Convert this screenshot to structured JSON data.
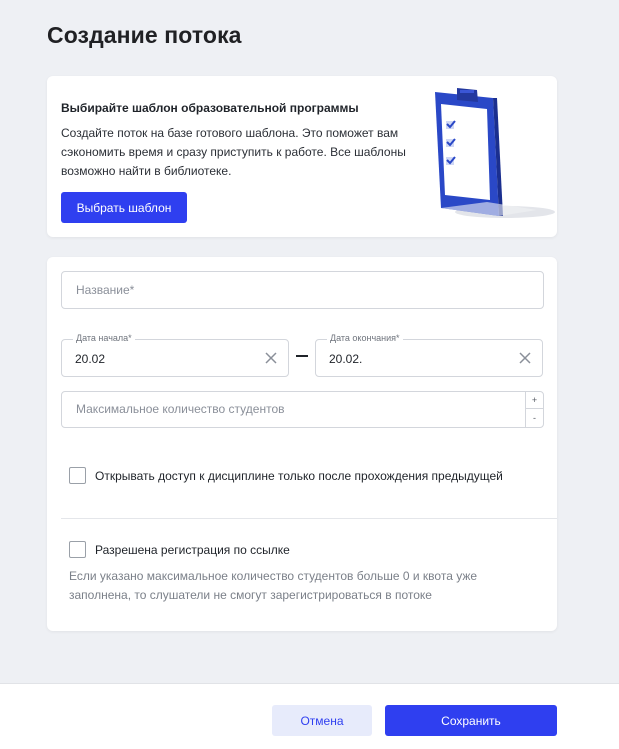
{
  "page": {
    "title": "Создание потока"
  },
  "template_promo": {
    "title": "Выбирайте шаблон образовательной программы",
    "text": "Создайте поток на базе готового шаблона. Это поможет вам сэкономить время и сразу приступить к работе. Все шаблоны возможно найти в библиотеке.",
    "choose_button": "Выбрать шаблон",
    "illustration": "clipboard-checklist-icon"
  },
  "form": {
    "name": {
      "placeholder": "Название*",
      "value": ""
    },
    "start_date": {
      "label": "Дата начала*",
      "value": "20.02"
    },
    "end_date": {
      "label": "Дата окончания*",
      "value": "20.02."
    },
    "separator": "—",
    "max_students": {
      "placeholder": "Максимальное количество студентов",
      "value": "",
      "plus": "+",
      "minus": "-"
    },
    "access_checkbox": {
      "label": "Открывать доступ к дисциплине только после прохождения предыдущей",
      "checked": false
    },
    "registration_checkbox": {
      "label": "Разрешена регистрация по ссылке",
      "checked": false
    },
    "registration_hint": "Если указано максимальное количество студентов больше 0 и квота уже заполнена, то слушатели не смогут зарегистрироваться в потоке"
  },
  "footer": {
    "cancel": "Отмена",
    "save": "Сохранить"
  },
  "colors": {
    "accent": "#2f3ff0",
    "background": "#eef0f4",
    "secondary_bg": "#e7ebfb"
  }
}
